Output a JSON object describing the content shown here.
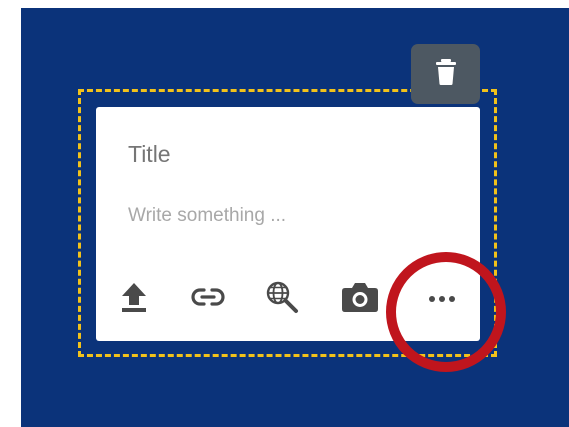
{
  "note": {
    "title_placeholder": "Title",
    "body_placeholder": "Write something ..."
  },
  "toolbar": {
    "items": [
      {
        "name": "upload",
        "icon": "upload-icon"
      },
      {
        "name": "link",
        "icon": "link-icon"
      },
      {
        "name": "web-search",
        "icon": "globe-search-icon"
      },
      {
        "name": "camera",
        "icon": "camera-icon"
      },
      {
        "name": "more",
        "icon": "more-horizontal-icon"
      }
    ]
  },
  "delete": {
    "icon": "trash-icon"
  },
  "colors": {
    "background": "#0b337a",
    "selection_border": "#f2c21a",
    "delete_button": "#4d5862",
    "highlight_ring": "#c0151d",
    "icon": "#4a4a4a"
  }
}
